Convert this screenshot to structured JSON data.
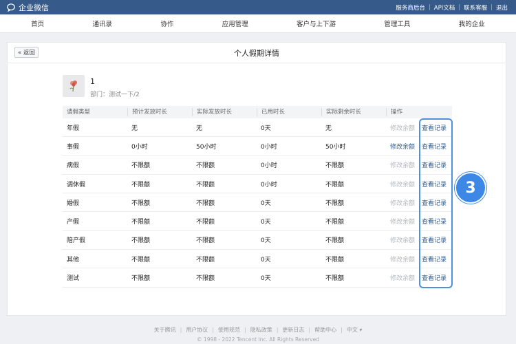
{
  "app": {
    "name": "企业微信"
  },
  "topbar": {
    "links": [
      "服务商后台",
      "API文档",
      "联系客服",
      "退出"
    ]
  },
  "nav": {
    "items": [
      "首页",
      "通讯录",
      "协作",
      "应用管理",
      "客户与上下游",
      "管理工具",
      "我的企业"
    ]
  },
  "page": {
    "back_label": "« 返回",
    "title": "个人假期详情"
  },
  "profile": {
    "name": "1",
    "dept": "部门：测试一下/2"
  },
  "table": {
    "headers": [
      "请假类型",
      "预计发放时长",
      "实际发放时长",
      "已用时长",
      "实际剩余时长",
      "操作"
    ],
    "rows": [
      {
        "type": "年假",
        "expected": "无",
        "actual": "无",
        "used": "0天",
        "remaining": "无",
        "edit": "修改余额",
        "view": "查看记录"
      },
      {
        "type": "事假",
        "expected": "0小时",
        "actual": "50小时",
        "used": "0小时",
        "remaining": "50小时",
        "edit": "修改余额",
        "view": "查看记录"
      },
      {
        "type": "病假",
        "expected": "不限额",
        "actual": "不限额",
        "used": "0小时",
        "remaining": "不限额",
        "edit": "修改余额",
        "view": "查看记录"
      },
      {
        "type": "调休假",
        "expected": "不限额",
        "actual": "不限额",
        "used": "0小时",
        "remaining": "不限额",
        "edit": "修改余额",
        "view": "查看记录"
      },
      {
        "type": "婚假",
        "expected": "不限额",
        "actual": "不限额",
        "used": "0天",
        "remaining": "不限额",
        "edit": "修改余额",
        "view": "查看记录"
      },
      {
        "type": "产假",
        "expected": "不限额",
        "actual": "不限额",
        "used": "0天",
        "remaining": "不限额",
        "edit": "修改余额",
        "view": "查看记录"
      },
      {
        "type": "陪产假",
        "expected": "不限额",
        "actual": "不限额",
        "used": "0天",
        "remaining": "不限额",
        "edit": "修改余额",
        "view": "查看记录"
      },
      {
        "type": "其他",
        "expected": "不限额",
        "actual": "不限额",
        "used": "0天",
        "remaining": "不限额",
        "edit": "修改余额",
        "view": "查看记录"
      },
      {
        "type": "测试",
        "expected": "不限额",
        "actual": "不限额",
        "used": "0天",
        "remaining": "不限额",
        "edit": "修改余额",
        "view": "查看记录"
      }
    ]
  },
  "annotation": {
    "step": "3"
  },
  "footer": {
    "links": [
      "关于腾讯",
      "用户协议",
      "使用规范",
      "隐私政策",
      "更新日志",
      "帮助中心",
      "中文 ▾"
    ],
    "copyright": "© 1998 - 2022 Tencent Inc. All Rights Reserved"
  },
  "colors": {
    "header_bg": "#365b8a",
    "link": "#2e5b92",
    "disabled": "#b3b6bb",
    "highlight": "#4d8fe0"
  },
  "icons": {
    "logo": "chat-bubble-icon",
    "avatar": "flower-icon"
  }
}
